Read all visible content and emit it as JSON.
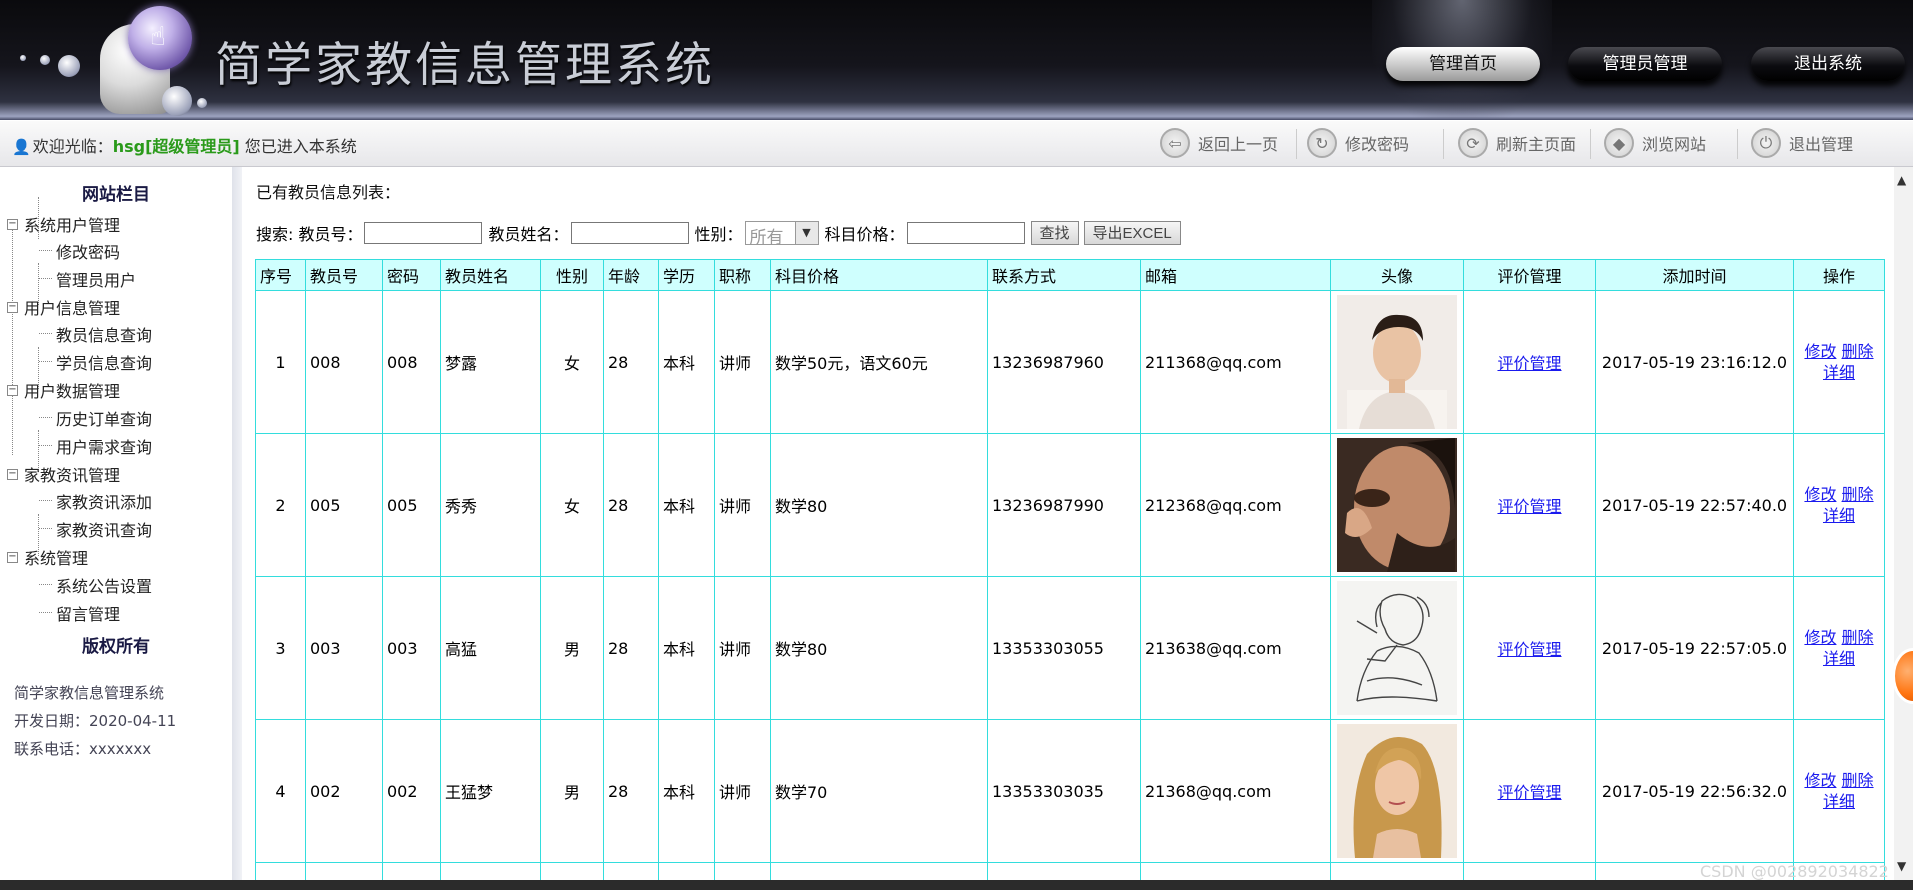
{
  "header": {
    "site_title": "简学家教信息管理系统",
    "nav": [
      "管理首页",
      "管理员管理",
      "退出系统"
    ]
  },
  "statusbar": {
    "welcome_prefix": "欢迎光临：",
    "username": "hsg[超级管理员]",
    "welcome_suffix": " 您已进入本系统",
    "tools": [
      {
        "label": "返回上一页",
        "icon": "back-arrow-icon",
        "glyph": "⇦"
      },
      {
        "label": "修改密码",
        "icon": "refresh-key-icon",
        "glyph": "↻"
      },
      {
        "label": "刷新主页面",
        "icon": "refresh-icon",
        "glyph": "⟳"
      },
      {
        "label": "浏览网站",
        "icon": "browse-icon",
        "glyph": "◆"
      },
      {
        "label": "退出管理",
        "icon": "power-icon",
        "glyph": "⏻"
      }
    ]
  },
  "sidebar": {
    "title": "网站栏目",
    "groups": [
      {
        "label": "系统用户管理",
        "items": [
          "修改密码",
          "管理员用户"
        ]
      },
      {
        "label": "用户信息管理",
        "items": [
          "教员信息查询",
          "学员信息查询"
        ]
      },
      {
        "label": "用户数据管理",
        "items": [
          "历史订单查询",
          "用户需求查询"
        ]
      },
      {
        "label": "家教资讯管理",
        "items": [
          "家教资讯添加",
          "家教资讯查询"
        ]
      },
      {
        "label": "系统管理",
        "items": [
          "系统公告设置",
          "留言管理"
        ]
      }
    ],
    "copyright_title": "版权所有",
    "info": [
      "简学家教信息管理系统",
      "开发日期：2020-04-11",
      "联系电话：xxxxxxx"
    ]
  },
  "main": {
    "list_title": "已有教员信息列表：",
    "search": {
      "label": "搜索: 教员号：",
      "name_label": "教员姓名：",
      "gender_label": "性别：",
      "gender_value": "所有",
      "price_label": "科目价格：",
      "find_button": "查找",
      "export_button": "导出EXCEL"
    },
    "columns": [
      "序号",
      "教员号",
      "密码",
      "教员姓名",
      "性别",
      "年龄",
      "学历",
      "职称",
      "科目价格",
      "联系方式",
      "邮箱",
      "头像",
      "评价管理",
      "添加时间",
      "操作"
    ],
    "rows": [
      {
        "no": "1",
        "id": "008",
        "pwd": "008",
        "name": "梦露",
        "gender": "女",
        "age": "28",
        "edu": "本科",
        "title": "讲师",
        "price": "数学50元，语文60元",
        "phone": "13236987960",
        "email": "211368@qq.com",
        "avatar": "avatar-male-white-shirt",
        "review": "评价管理",
        "time": "2017-05-19 23:16:12.0",
        "edit": "修改",
        "del": "删除",
        "detail": "详细"
      },
      {
        "no": "2",
        "id": "005",
        "pwd": "005",
        "name": "秀秀",
        "gender": "女",
        "age": "28",
        "edu": "本科",
        "title": "讲师",
        "price": "数学80",
        "phone": "13236987990",
        "email": "212368@qq.com",
        "avatar": "avatar-male-closeup",
        "review": "评价管理",
        "time": "2017-05-19 22:57:40.0",
        "edit": "修改",
        "del": "删除",
        "detail": "详细"
      },
      {
        "no": "3",
        "id": "003",
        "pwd": "003",
        "name": "高猛",
        "gender": "男",
        "age": "28",
        "edu": "本科",
        "title": "讲师",
        "price": "数学80",
        "phone": "13353303055",
        "email": "213638@qq.com",
        "avatar": "avatar-sketch",
        "review": "评价管理",
        "time": "2017-05-19 22:57:05.0",
        "edit": "修改",
        "del": "删除",
        "detail": "详细"
      },
      {
        "no": "4",
        "id": "002",
        "pwd": "002",
        "name": "王猛梦",
        "gender": "男",
        "age": "28",
        "edu": "本科",
        "title": "讲师",
        "price": "数学70",
        "phone": "13353303035",
        "email": "21368@qq.com",
        "avatar": "avatar-female-blonde",
        "review": "评价管理",
        "time": "2017-05-19 22:56:32.0",
        "edit": "修改",
        "del": "删除",
        "detail": "详细"
      }
    ]
  },
  "watermark": "CSDN @002892034822",
  "colors": {
    "table_border": "#33dddd",
    "table_header": "#cffffe",
    "link": "#1a1aee",
    "username": "#2a9a1a"
  }
}
